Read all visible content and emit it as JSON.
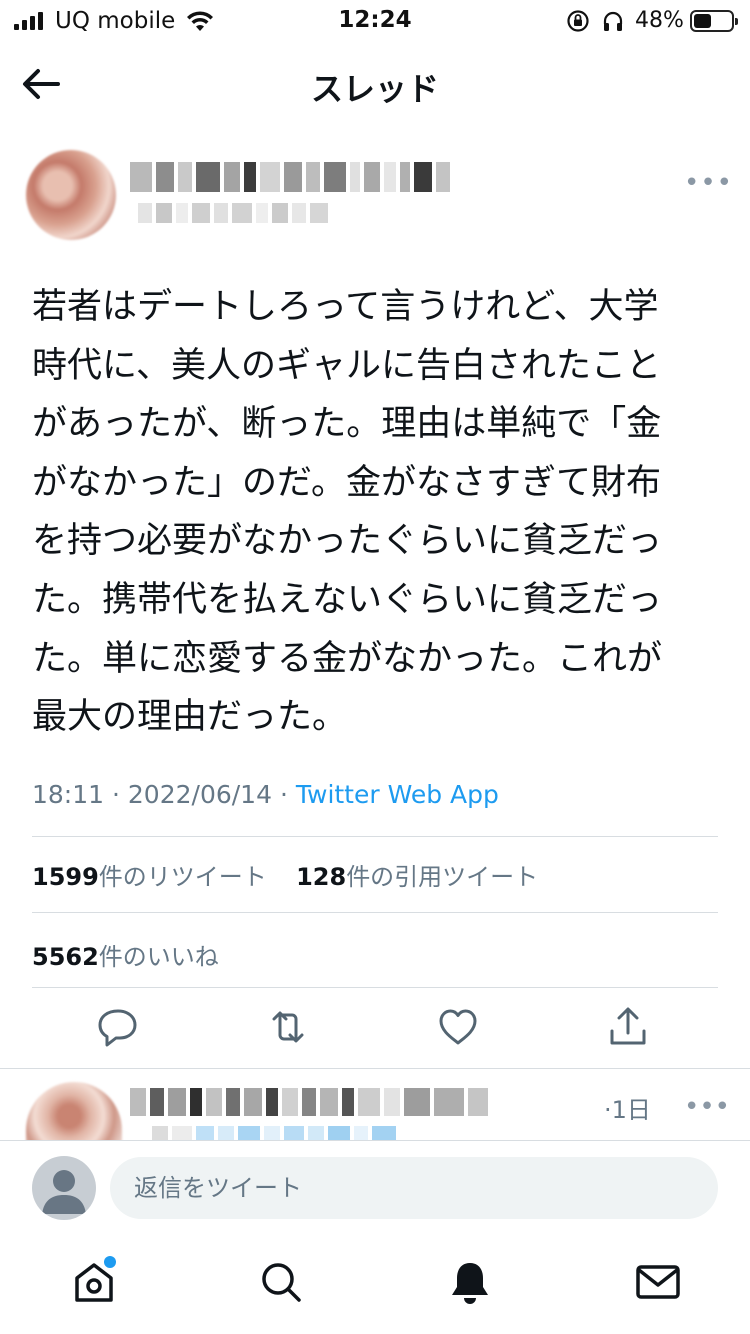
{
  "status_bar": {
    "carrier": "UQ mobile",
    "time": "12:24",
    "battery_percent": "48%",
    "battery_level": 0.48
  },
  "header": {
    "title": "スレッド"
  },
  "tweet": {
    "text": "若者はデートしろって言うけれど、大学\n時代に、美人のギャルに告白されたこと\nがあったが、断った。理由は単純で「金\nがなかった」のだ。金がなさすぎて財布\nを持つ必要がなかったぐらいに貧乏だっ\nた。携帯代を払えないぐらいに貧乏だっ\nた。単に恋愛する金がなかった。これが\n最大の理由だった。",
    "time": "18:11",
    "date": "2022/06/14",
    "separator": "·",
    "source_app": "Twitter Web App",
    "retweets_count": "1599",
    "retweets_label": "件のリツイート",
    "quotes_count": "128",
    "quotes_label": "件の引用ツイート",
    "likes_count": "5562",
    "likes_label": "件のいいね"
  },
  "reply": {
    "time": "·1日"
  },
  "compose": {
    "placeholder": "返信をツイート"
  },
  "icons": {
    "back": "back-arrow-icon",
    "more": "more-dots-icon",
    "reply": "reply-icon",
    "retweet": "retweet-icon",
    "like": "heart-icon",
    "share": "share-icon",
    "home": "home-icon",
    "search": "search-icon",
    "notifications": "bell-icon",
    "messages": "mail-icon"
  },
  "colors": {
    "accent": "#1d9bf0",
    "secondary_text": "#657786",
    "divider": "#d8dde1"
  }
}
